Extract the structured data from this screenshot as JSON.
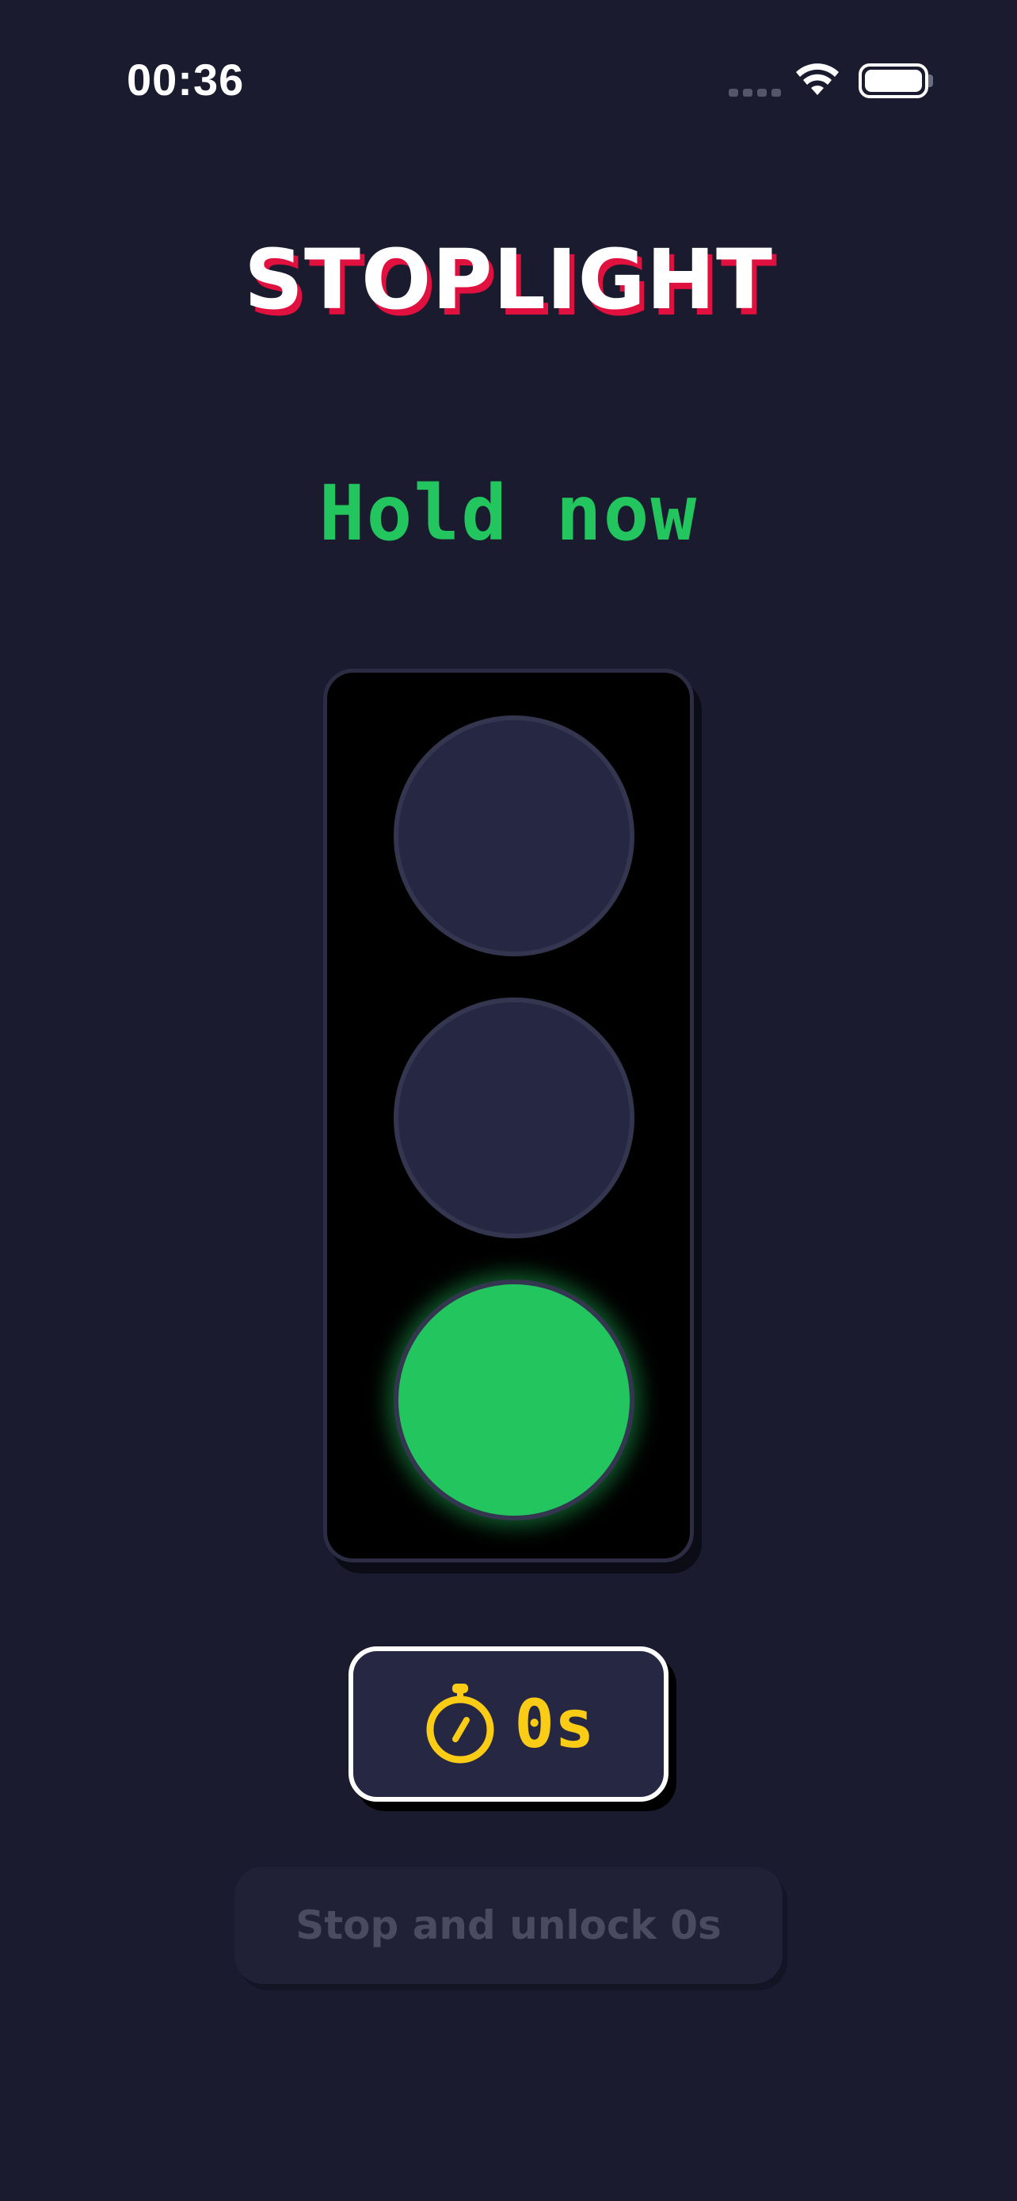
{
  "status_bar": {
    "time": "00:36",
    "signal_icon": "cellular-signal-icon",
    "wifi_icon": "wifi-icon",
    "battery_icon": "battery-icon"
  },
  "app": {
    "title": "STOPLIGHT",
    "instruction": "Hold now"
  },
  "stoplight": {
    "active_light": "green",
    "lights": [
      "red",
      "yellow",
      "green"
    ]
  },
  "timer": {
    "icon": "stopwatch-icon",
    "value": "0s"
  },
  "unlock_button": {
    "label": "Stop and unlock 0s",
    "enabled": false
  },
  "colors": {
    "background": "#1a1b2e",
    "accent_red": "#e0103f",
    "active_green": "#22c55e",
    "timer_yellow": "#facc15",
    "inactive_lamp": "#262742"
  }
}
